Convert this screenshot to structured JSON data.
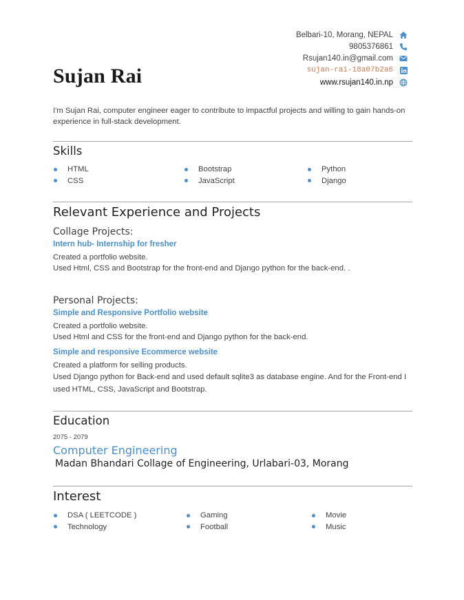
{
  "header": {
    "name": "Sujan Rai",
    "contact": {
      "address": "Belbari-10, Morang, NEPAL",
      "phone": "9805376861",
      "email": "Rsujan140.in@gmail.com",
      "linkedin": "sujan-rai-18a07b2a6",
      "website": "www.rsujan140.in.np"
    }
  },
  "summary": "I'm Sujan Rai, computer engineer eager to contribute to impactful projects and willing to gain hands-on experience in full-stack development.",
  "skills": {
    "heading": "Skills",
    "col1": [
      "HTML",
      "CSS"
    ],
    "col2": [
      "Bootstrap",
      "JavaScript"
    ],
    "col3": [
      "Python",
      "Django"
    ]
  },
  "experience": {
    "heading": "Relevant Experience and Projects",
    "collage": {
      "heading": "Collage Projects:",
      "project_title": "Intern hub- Internship for fresher",
      "line1": "Created a portfolio website.",
      "line2": "Used Html, CSS and Bootstrap for the front-end and Django python for the back-end. ."
    },
    "personal": {
      "heading": "Personal Projects:",
      "p1_title": "Simple and Responsive Portfolio website",
      "p1_line1": "Created a portfolio website.",
      "p1_line2": "Used Html and CSS for the front-end and Django python for the back-end.",
      "p2_title": "Simple and responsive Ecommerce website",
      "p2_line1": "Created a platform for selling products.",
      "p2_line2": "Used Django python for Back-end and used default sqlite3 as database engine. And for the Front-end I used HTML, CSS, JavaScript and Bootstrap."
    }
  },
  "education": {
    "heading": "Education",
    "years": "2075 - 2079",
    "degree": "Computer Engineering",
    "school": "Madan Bhandari Collage of Engineering, Urlabari-03, Morang"
  },
  "interest": {
    "heading": "Interest",
    "col1": [
      "DSA ( LEETCODE )",
      "Technology"
    ],
    "col2": [
      "Gaming",
      "Football"
    ],
    "col3": [
      "Movie",
      "Music"
    ]
  },
  "colors": {
    "accent": "#4a8fd0",
    "mono_link": "#d07a4e",
    "rule": "#a6a6a6"
  }
}
